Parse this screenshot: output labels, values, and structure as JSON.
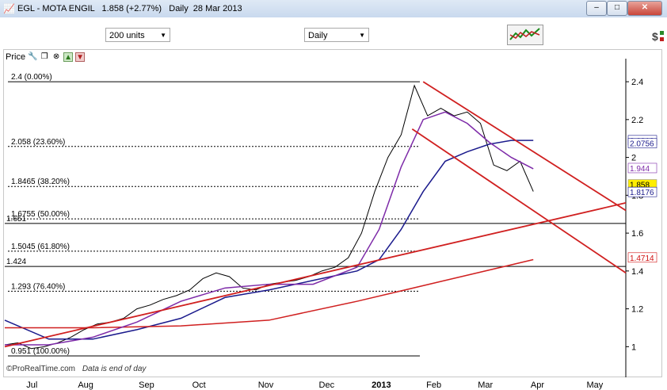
{
  "window": {
    "title": "EGL - MOTA ENGIL   1.858 (+2.77%)   Daily  28 Mar 2013",
    "minimize": "–",
    "restore": "□",
    "close": "✕"
  },
  "toolbar": {
    "units_value": "200 units",
    "period_value": "Daily",
    "indicator_icon": "chart-indicator-icon",
    "side_icon": "price-toggle-icon"
  },
  "price_panel": {
    "label": "Price",
    "icons": [
      "wrench-icon",
      "windows-icon",
      "close-circle-icon",
      "arrow-up-icon",
      "arrow-down-icon"
    ]
  },
  "chart_data": {
    "type": "line",
    "title": "",
    "xlabel": "",
    "ylabel": "",
    "x_ticks": [
      "Jul",
      "Aug",
      "Sep",
      "Oct",
      "Nov",
      "Dec",
      "2013",
      "Feb",
      "Mar",
      "Apr",
      "May"
    ],
    "y_ticks": [
      "2.4",
      "2.2",
      "2",
      "1.8",
      "1.6",
      "1.4",
      "1.2",
      "1"
    ],
    "ylim": [
      0.88,
      2.48
    ],
    "grid": false,
    "fibonacci_levels": [
      {
        "label": "2.4 (0.00%)",
        "value": 2.4
      },
      {
        "label": "2.058 (23.60%)",
        "value": 2.058
      },
      {
        "label": "1.8465 (38.20%)",
        "value": 1.8465
      },
      {
        "label": "1.6755 (50.00%)",
        "value": 1.6755
      },
      {
        "label": "1.5045 (61.80%)",
        "value": 1.5045
      },
      {
        "label": "1.293 (76.40%)",
        "value": 1.293
      },
      {
        "label": "0.951 (100.00%)",
        "value": 0.951
      }
    ],
    "horizontal_lines": [
      {
        "label": "1.424",
        "value": 1.424
      },
      {
        "label": "1.651",
        "value": 1.651
      }
    ],
    "right_labels": [
      {
        "text": "2.0912",
        "value": 2.0912,
        "color": "#1a1a8c",
        "bg": "#ffffff"
      },
      {
        "text": "2.0756",
        "value": 2.0756,
        "color": "#1a1a8c",
        "bg": "#ffffff"
      },
      {
        "text": "1.944",
        "value": 1.944,
        "color": "#7d2aa8",
        "bg": "#ffffff"
      },
      {
        "text": "1.858",
        "value": 1.858,
        "color": "#000000",
        "bg": "#ffee00"
      },
      {
        "text": "1.8176",
        "value": 1.8176,
        "color": "#1a1a8c",
        "bg": "#ffffff"
      },
      {
        "text": "1.4714",
        "value": 1.4714,
        "color": "#d01010",
        "bg": "#ffffff"
      }
    ],
    "series": [
      {
        "name": "",
        "color": "#000000",
        "x": [
          0,
          6,
          12,
          18,
          24,
          30,
          36,
          42,
          48,
          54,
          60,
          66,
          72,
          78,
          84,
          90,
          96,
          102,
          108,
          114,
          120,
          126,
          132,
          138,
          144,
          150,
          156,
          162,
          168,
          174,
          180,
          186,
          192,
          198,
          204,
          210,
          216,
          222,
          228,
          234,
          240
        ],
        "values": [
          1.01,
          1.02,
          0.99,
          1.0,
          1.02,
          1.05,
          1.09,
          1.12,
          1.13,
          1.15,
          1.2,
          1.22,
          1.25,
          1.27,
          1.3,
          1.36,
          1.39,
          1.37,
          1.31,
          1.3,
          1.33,
          1.34,
          1.35,
          1.37,
          1.4,
          1.42,
          1.47,
          1.6,
          1.82,
          2.0,
          2.12,
          2.38,
          2.22,
          2.26,
          2.22,
          2.24,
          2.18,
          1.96,
          1.93,
          1.98,
          1.82
        ]
      },
      {
        "name": "",
        "color": "#1a1a8c",
        "x": [
          0,
          20,
          40,
          60,
          80,
          100,
          120,
          140,
          160,
          170,
          180,
          190,
          200,
          210,
          220,
          230,
          240
        ],
        "values": [
          1.14,
          1.04,
          1.04,
          1.09,
          1.15,
          1.26,
          1.3,
          1.35,
          1.4,
          1.46,
          1.62,
          1.82,
          1.98,
          2.03,
          2.07,
          2.09,
          2.09
        ]
      },
      {
        "name": "",
        "color": "#d02020",
        "x": [
          0,
          40,
          80,
          120,
          160,
          200,
          240
        ],
        "values": [
          1.1,
          1.1,
          1.11,
          1.14,
          1.24,
          1.35,
          1.46
        ]
      },
      {
        "name": "",
        "color": "#7d2aa8",
        "x": [
          0,
          20,
          40,
          60,
          80,
          100,
          120,
          140,
          160,
          170,
          180,
          190,
          200,
          210,
          220,
          230,
          240
        ],
        "values": [
          1.01,
          1.01,
          1.05,
          1.13,
          1.24,
          1.31,
          1.33,
          1.33,
          1.42,
          1.62,
          1.95,
          2.2,
          2.24,
          2.18,
          2.08,
          2.0,
          1.94
        ]
      }
    ],
    "trendlines": [
      {
        "name": "",
        "color": "#d02020",
        "x": [
          190,
          282
        ],
        "values": [
          2.4,
          1.72
        ]
      },
      {
        "name": "",
        "color": "#d02020",
        "x": [
          185,
          282
        ],
        "values": [
          2.15,
          1.39
        ]
      },
      {
        "name": "",
        "color": "#d02020",
        "x": [
          0,
          282
        ],
        "values": [
          1.0,
          1.76
        ]
      }
    ]
  },
  "footer": {
    "brand": "©ProRealTime.com",
    "note": "Data is end of day"
  }
}
